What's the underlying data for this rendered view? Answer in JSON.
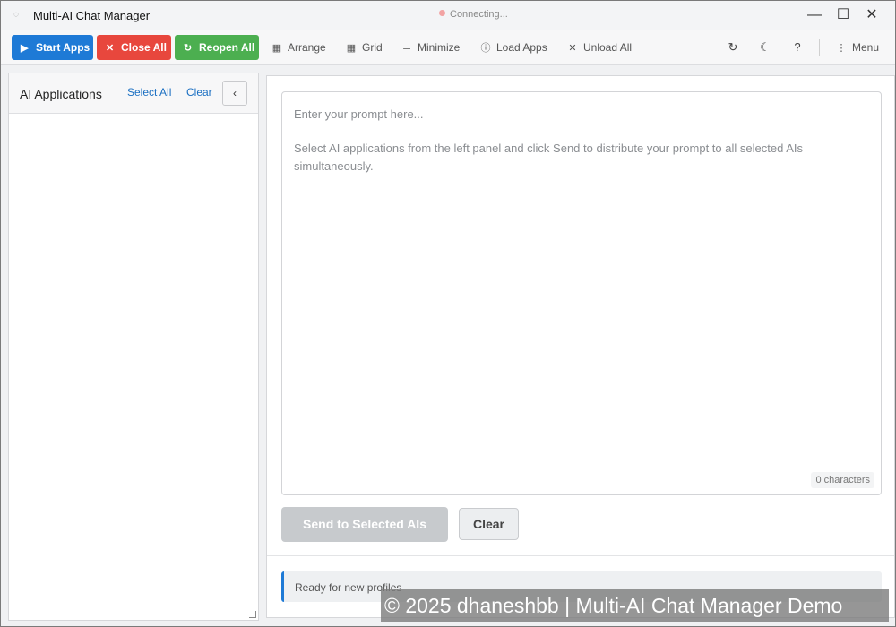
{
  "window": {
    "title": "Multi-AI Chat Manager",
    "connection_status": "Connecting...",
    "controls": {
      "minimize": "—",
      "maximize": "☐",
      "close": "✕"
    }
  },
  "toolbar": {
    "primary_buttons": [
      {
        "label": "Start Apps",
        "icon": "play-icon",
        "color": "#1e7ad6"
      },
      {
        "label": "Close All",
        "icon": "x-icon",
        "color": "#e8473d"
      },
      {
        "label": "Reopen All",
        "icon": "refresh-icon",
        "color": "#4caf50"
      }
    ],
    "actions": [
      {
        "label": "Arrange",
        "icon": "grid-icon"
      },
      {
        "label": "Grid",
        "icon": "grid-icon"
      },
      {
        "label": "Minimize",
        "icon": "minimize-icon"
      },
      {
        "label": "Load Apps",
        "icon": "info-icon"
      },
      {
        "label": "Unload All",
        "icon": "x-icon"
      }
    ],
    "right_icons": [
      "refresh-icon",
      "moon-icon",
      "help-icon"
    ],
    "menu_label": "Menu"
  },
  "sidebar": {
    "title": "AI Applications",
    "select_all": "Select All",
    "clear": "Clear",
    "collapse_icon": "chevron-left-icon"
  },
  "main": {
    "prompt_placeholder": "Enter your prompt here...",
    "help_text": "Select AI applications from the left panel and click Send to distribute your prompt to all selected AIs simultaneously.",
    "char_count": "0 characters",
    "send_button": "Send to Selected AIs",
    "clear_button": "Clear",
    "status_message": "Ready for new profiles"
  },
  "watermark": "© 2025 dhaneshbb | Multi-AI Chat Manager Demo"
}
